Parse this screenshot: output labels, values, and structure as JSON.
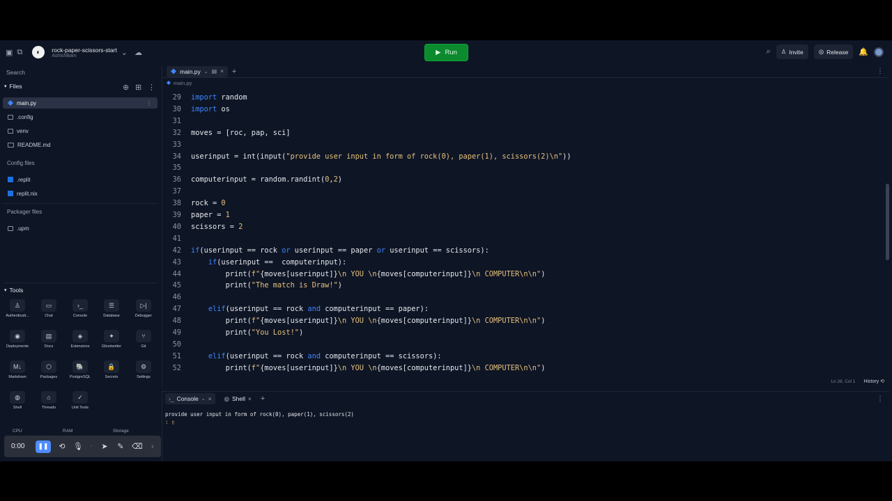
{
  "topbar": {
    "repl_title": "rock-paper-scissors-start",
    "repl_owner": "AshishBam",
    "run_label": "Run",
    "invite_label": "Invite",
    "release_label": "Release"
  },
  "sidebar": {
    "search_placeholder": "Search",
    "files_heading": "Files",
    "files": [
      {
        "name": "main.py",
        "icon": "python-icon"
      },
      {
        "name": ".config",
        "icon": "folder-icon"
      },
      {
        "name": "venv",
        "icon": "folder-icon"
      },
      {
        "name": "README.md",
        "icon": "markdown-icon"
      }
    ],
    "config_heading": "Config files",
    "config_files": [
      {
        "name": ".replit"
      },
      {
        "name": "replit.nix"
      }
    ],
    "packager_heading": "Packager files",
    "packager_files": [
      {
        "name": ".upm"
      }
    ],
    "tools_heading": "Tools",
    "tools": [
      {
        "label": "Authenticati...",
        "glyph": "♙"
      },
      {
        "label": "Chat",
        "glyph": "▭"
      },
      {
        "label": "Console",
        "glyph": "›_"
      },
      {
        "label": "Database",
        "glyph": "☰"
      },
      {
        "label": "Debugger",
        "glyph": "▷|"
      },
      {
        "label": "Deployments",
        "glyph": "◉"
      },
      {
        "label": "Docs",
        "glyph": "▤"
      },
      {
        "label": "Extensions",
        "glyph": "◈"
      },
      {
        "label": "Ghostwriter",
        "glyph": "✦"
      },
      {
        "label": "Git",
        "glyph": "⑂"
      },
      {
        "label": "Markdown",
        "glyph": "M↓"
      },
      {
        "label": "Packages",
        "glyph": "⬡"
      },
      {
        "label": "PostgreSQL",
        "glyph": "🐘"
      },
      {
        "label": "Secrets",
        "glyph": "🔒"
      },
      {
        "label": "Settings",
        "glyph": "⚙"
      },
      {
        "label": "Shell",
        "glyph": "◍"
      },
      {
        "label": "Threads",
        "glyph": "⌂"
      },
      {
        "label": "Unit Tests",
        "glyph": "✓"
      }
    ],
    "usage": {
      "cpu": "CPU",
      "ram": "RAM",
      "storage": "Storage"
    },
    "recorder": {
      "time": "0:00"
    }
  },
  "editor": {
    "tab_label": "main.py",
    "breadcrumb": "main.py",
    "status_position": "Ln 28, Col 1",
    "status_history": "History",
    "lines": [
      {
        "n": "29",
        "html": "<span class=\"kw\">import</span> random"
      },
      {
        "n": "30",
        "html": "<span class=\"kw\">import</span> os"
      },
      {
        "n": "31",
        "html": ""
      },
      {
        "n": "32",
        "html": "moves = [roc, pap, sci]"
      },
      {
        "n": "33",
        "html": ""
      },
      {
        "n": "34",
        "html": "userinput = int(input(<span class=\"st\">\"provide user input in form of rock(0), paper(1), scissors(2)\\n\"</span>))"
      },
      {
        "n": "35",
        "html": ""
      },
      {
        "n": "36",
        "html": "computerinput = random.randint(<span class=\"nm\">0</span>,<span class=\"nm\">2</span>)"
      },
      {
        "n": "37",
        "html": ""
      },
      {
        "n": "38",
        "html": "rock = <span class=\"nm\">0</span>"
      },
      {
        "n": "39",
        "html": "paper = <span class=\"nm\">1</span>"
      },
      {
        "n": "40",
        "html": "scissors = <span class=\"nm\">2</span>"
      },
      {
        "n": "41",
        "html": ""
      },
      {
        "n": "42",
        "html": "<span class=\"kw\">if</span>(userinput == rock <span class=\"kw\">or</span> userinput == paper <span class=\"kw\">or</span> userinput == scissors):"
      },
      {
        "n": "43",
        "html": "    <span class=\"kw\">if</span>(userinput ==  computerinput):"
      },
      {
        "n": "44",
        "html": "        print(<span class=\"st\">f\"</span>{moves[userinput]}<span class=\"st\">\\n YOU \\n</span>{moves[computerinput]}<span class=\"st\">\\n COMPUTER\\n\\n\"</span>)"
      },
      {
        "n": "45",
        "html": "        print(<span class=\"st\">\"The match is Draw!\"</span>)"
      },
      {
        "n": "46",
        "html": ""
      },
      {
        "n": "47",
        "html": "    <span class=\"kw\">elif</span>(userinput == rock <span class=\"kw\">and</span> computerinput == paper):"
      },
      {
        "n": "48",
        "html": "        print(<span class=\"st\">f\"</span>{moves[userinput]}<span class=\"st\">\\n YOU \\n</span>{moves[computerinput]}<span class=\"st\">\\n COMPUTER\\n\\n\"</span>)"
      },
      {
        "n": "49",
        "html": "        print(<span class=\"st\">\"You Lost!\"</span>)"
      },
      {
        "n": "50",
        "html": ""
      },
      {
        "n": "51",
        "html": "    <span class=\"kw\">elif</span>(userinput == rock <span class=\"kw\">and</span> computerinput == scissors):"
      },
      {
        "n": "52",
        "html": "        print(<span class=\"st\">f\"</span>{moves[userinput]}<span class=\"st\">\\n YOU \\n</span>{moves[computerinput]}<span class=\"st\">\\n COMPUTER\\n\\n\"</span>)"
      }
    ]
  },
  "console": {
    "tabs": [
      {
        "label": "Console"
      },
      {
        "label": "Shell"
      }
    ],
    "output": "provide user input in form of rock(0), paper(1), scissors(2)",
    "prompt": ": ▯"
  },
  "colors": {
    "run_button": "#0b8a2e",
    "keyword": "#3d86ff",
    "string": "#e6c07b",
    "accent": "#4f8cff"
  }
}
